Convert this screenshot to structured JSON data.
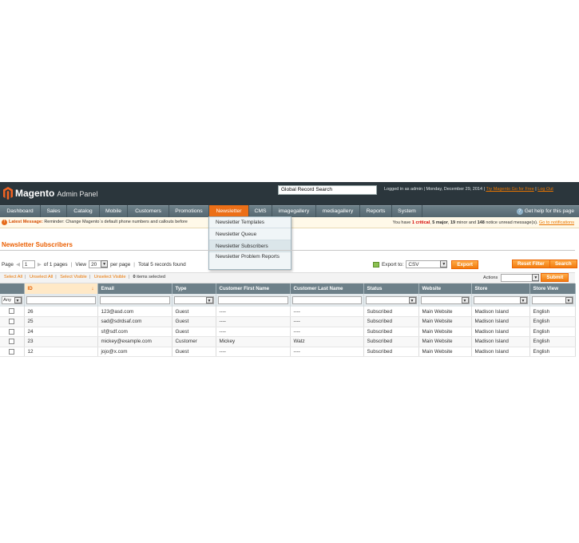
{
  "header": {
    "brand": "Magento",
    "subtitle": "Admin Panel",
    "search_value": "Global Record Search",
    "logged_in": "Logged in as admin",
    "date": "Monday, December 29, 2014",
    "try_link": "Try Magento Go for Free",
    "logout": "Log Out"
  },
  "nav": {
    "items": [
      "Dashboard",
      "Sales",
      "Catalog",
      "Mobile",
      "Customers",
      "Promotions",
      "Newsletter",
      "CMS",
      "imagegallery",
      "mediagallery",
      "Reports",
      "System"
    ],
    "help": "Get help for this page"
  },
  "newsletter_menu": [
    "Newsletter Templates",
    "Newsletter Queue",
    "Newsletter Subscribers",
    "Newsletter Problem Reports"
  ],
  "notice": {
    "label": "Latest Message:",
    "text": "Reminder: Change Magento`s default phone numbers and callouts before",
    "summary_prefix": "You have",
    "critical": "1 critical",
    "major": "5 major",
    "minor": "19",
    "notice_count": "148",
    "summary_mid": "minor and",
    "summary_end": "notice unread message(s).",
    "goto": "Go to notifications"
  },
  "page": {
    "title": "Newsletter Subscribers"
  },
  "pager": {
    "page_label": "Page",
    "page_value": "1",
    "of_pages": "of 1 pages",
    "view_label": "View",
    "per_page_value": "20",
    "per_page_label": "per page",
    "total": "Total 5 records found",
    "export_label": "Export to:",
    "export_format": "CSV",
    "export_btn": "Export",
    "reset_btn": "Reset Filter",
    "search_btn": "Search"
  },
  "mass": {
    "select_all": "Select All",
    "unselect_all": "Unselect All",
    "select_visible": "Select Visible",
    "unselect_visible": "Unselect Visible",
    "count": "0",
    "count_label": "items selected",
    "actions_label": "Actions",
    "submit": "Submit"
  },
  "grid": {
    "columns": [
      "ID",
      "Email",
      "Type",
      "Customer First Name",
      "Customer Last Name",
      "Status",
      "Website",
      "Store",
      "Store View"
    ],
    "any": "Any",
    "rows": [
      [
        "26",
        "123@asd.com",
        "Guest",
        "----",
        "----",
        "Subscribed",
        "Main Website",
        "Madison Island",
        "English"
      ],
      [
        "25",
        "sad@sdrdsaf.com",
        "Guest",
        "----",
        "----",
        "Subscribed",
        "Main Website",
        "Madison Island",
        "English"
      ],
      [
        "24",
        "sf@sdf.com",
        "Guest",
        "----",
        "----",
        "Subscribed",
        "Main Website",
        "Madison Island",
        "English"
      ],
      [
        "23",
        "mickey@example.com",
        "Customer",
        "Mickey",
        "Watz",
        "Subscribed",
        "Main Website",
        "Madison Island",
        "English"
      ],
      [
        "12",
        "jojo@x.com",
        "Guest",
        "----",
        "----",
        "Subscribed",
        "Main Website",
        "Madison Island",
        "English"
      ]
    ]
  },
  "colors": {
    "accent": "#ec6f17",
    "header_bg": "#2b363c",
    "nav_bg": "#6d8089"
  }
}
